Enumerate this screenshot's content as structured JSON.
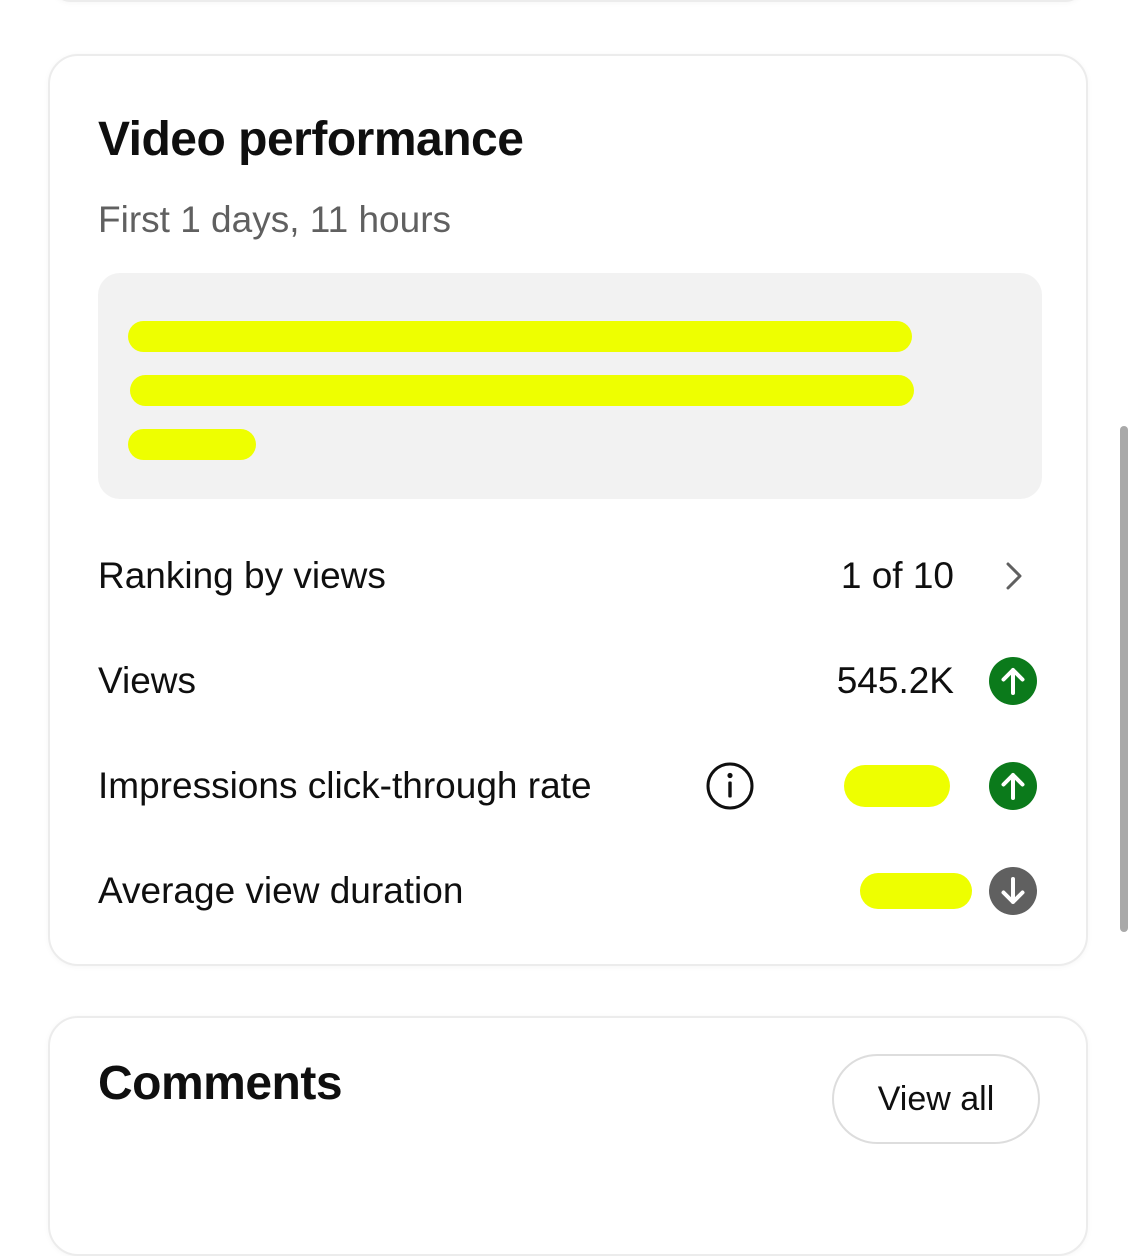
{
  "video_performance": {
    "title": "Video performance",
    "subtitle": "First 1 days, 11 hours",
    "insight_lines": [
      "",
      "",
      ""
    ],
    "rows": [
      {
        "label": "Ranking by views",
        "value": "1 of 10",
        "icon": "chevron-right-icon"
      },
      {
        "label": "Views",
        "value": "545.2K",
        "icon": "arrow-up-circle-icon",
        "trend": "up"
      },
      {
        "label": "Impressions click-through rate",
        "value": "",
        "icon": "arrow-up-circle-icon",
        "trend": "up",
        "info_icon": "info-icon"
      },
      {
        "label": "Average view duration",
        "value": "",
        "icon": "arrow-down-circle-icon",
        "trend": "down"
      }
    ]
  },
  "comments": {
    "title": "Comments",
    "view_all_label": "View all"
  },
  "colors": {
    "trend_up": "#0b7a1b",
    "trend_down": "#606060",
    "redaction": "#eeff00",
    "insight_bg": "#f2f2f2",
    "subtitle": "#606060"
  }
}
